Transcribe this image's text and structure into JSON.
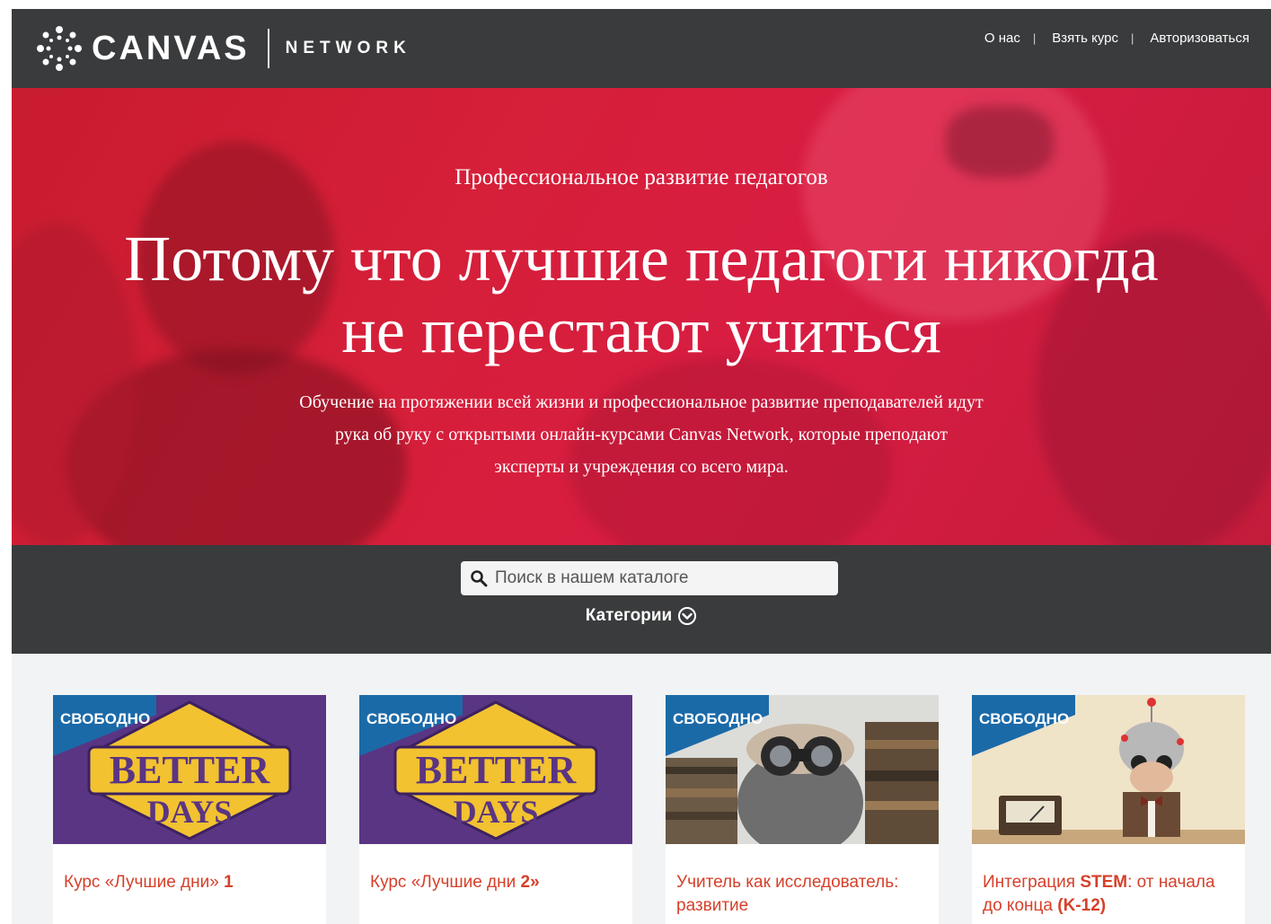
{
  "header": {
    "logo_text": "CANVAS",
    "logo_sub": "NETWORK",
    "nav": [
      {
        "label": "О нас"
      },
      {
        "label": "Взять курс"
      },
      {
        "label": "Авторизоваться"
      }
    ]
  },
  "hero": {
    "kicker": "Профессиональное развитие педагогов",
    "title": "Потому что лучшие педагоги никогда не перестают учиться",
    "text": "Обучение на протяжении всей жизни и профессиональное развитие преподавателей идут рука об руку с открытыми онлайн-курсами Canvas Network, которые преподают эксперты и учреждения со всего мира."
  },
  "search": {
    "placeholder": "Поиск в нашем каталоге",
    "categories_label": "Категории"
  },
  "cards": [
    {
      "badge": "СВОБОДНО",
      "title_a": "Курс «Лучшие дни» ",
      "title_b": "1",
      "title_c": "",
      "image": "better-days-logo",
      "image_text_1": "BETTER",
      "image_text_2": "DAYS"
    },
    {
      "badge": "СВОБОДНО",
      "title_a": "Курс «Лучшие дни ",
      "title_b": "2»",
      "title_c": "",
      "image": "better-days-logo",
      "image_text_1": "BETTER",
      "image_text_2": "DAYS"
    },
    {
      "badge": "СВОБОДНО",
      "title_a": "Учитель как исследователь: развитие",
      "title_b": "",
      "title_c": "",
      "image": "binoculars-photo"
    },
    {
      "badge": "СВОБОДНО",
      "title_a": "Интеграция ",
      "title_b": "STEM",
      "title_c": ": от начала до конца ",
      "title_d": "(K-12)",
      "image": "robot-kid-photo"
    }
  ],
  "colors": {
    "header_bg": "#3a3b3c",
    "hero_red": "#d61f39",
    "badge_blue": "#1b6aa8",
    "card_title": "#d6402a",
    "better_days_purple": "#5a3583",
    "better_days_gold": "#f2c230"
  }
}
